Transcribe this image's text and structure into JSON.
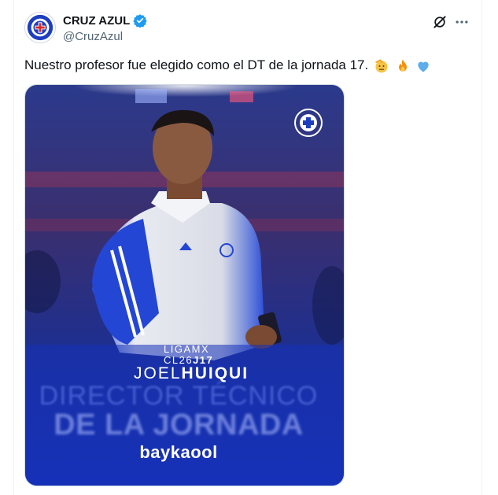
{
  "author": {
    "display_name": "CRUZ AZUL",
    "handle": "@CruzAzul",
    "verified": true
  },
  "tweet": {
    "text": "Nuestro profesor fue elegido como el DT de la jornada 17.",
    "emojis": [
      "saluting-face",
      "fire",
      "blue-heart"
    ]
  },
  "media": {
    "league_line1": "LIGAMX",
    "league_line2_prefix": "CL26",
    "league_line2_bold": "J17",
    "coach_first": "JOEL",
    "coach_last": "HUIQUI",
    "award_line1": "DIRECTOR TÉCNICO",
    "award_line2": "DE LA JORNADA",
    "sponsor": "baykaool"
  },
  "colors": {
    "accent_blue": "#1d3fbf",
    "verified_blue": "#1d9bf0",
    "text_primary": "#0f1419",
    "text_secondary": "#536471"
  },
  "icons": {
    "grok": "grok-icon",
    "more": "more-options-icon"
  }
}
